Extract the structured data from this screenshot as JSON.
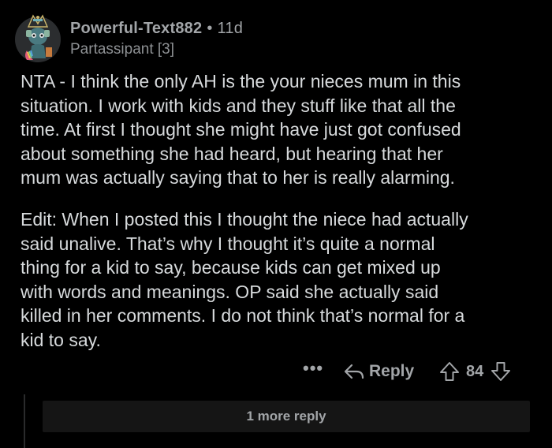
{
  "comment": {
    "author": "Powerful-Text882",
    "separator": "•",
    "age": "11d",
    "flair": "Partassipant [3]",
    "paragraphs": [
      [
        "NTA - I think the only AH is the your nieces mum in this",
        "situation. I work with kids and they stuff like that all the",
        "time. At first I thought she might have just got confused",
        "about something she had heard, but hearing that her",
        "mum was actually saying that to her is really alarming."
      ],
      [
        "Edit: When I posted this I thought the niece had actually",
        "said unalive. That’s why I thought it’s quite a normal",
        "thing for a kid to say, because kids can get mixed up",
        "with words and meanings. OP said she actually said",
        "killed in her comments. I do not think that’s normal for a",
        "kid to say."
      ]
    ],
    "actions": {
      "more_icon": "ellipsis-icon",
      "more_label": "•••",
      "reply_icon": "reply-arrow-icon",
      "reply_label": "Reply",
      "upvote_icon": "upvote-arrow-icon",
      "score": "84",
      "downvote_icon": "downvote-arrow-icon"
    },
    "more_replies_label": "1 more reply"
  },
  "colors": {
    "background": "#000000",
    "text": "#d7dadc",
    "meta": "#a2a5a8",
    "more_replies_bg": "#151515"
  }
}
